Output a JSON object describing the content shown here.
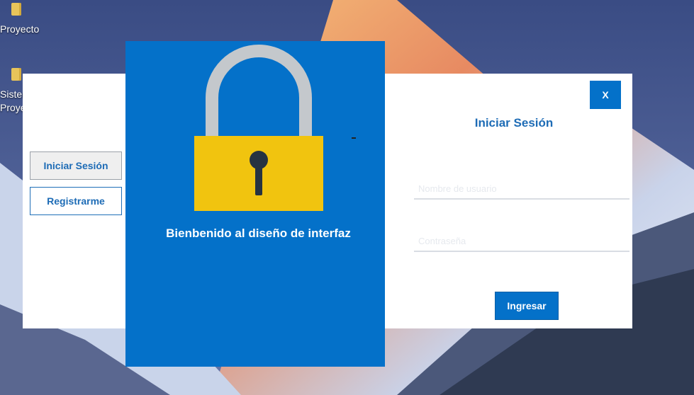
{
  "desktop": {
    "icons": [
      {
        "label": "Proyecto"
      },
      {
        "label_line1": "Sister",
        "label_line2": "Proye"
      }
    ]
  },
  "dialog": {
    "side_buttons": {
      "login": "Iniciar Sesión",
      "register": "Registrarme"
    },
    "welcome_text": "Bienbenido al diseño de interfaz",
    "close_label": "X",
    "form": {
      "title": "Iniciar Sesión",
      "username_placeholder": "Nombre de usuario",
      "password_placeholder": "Contraseña",
      "submit_label": "Ingresar"
    },
    "colors": {
      "accent": "#0471c9",
      "lock_body": "#f1c40f",
      "lock_shackle": "#c4c8cc",
      "keyhole": "#263341"
    }
  }
}
